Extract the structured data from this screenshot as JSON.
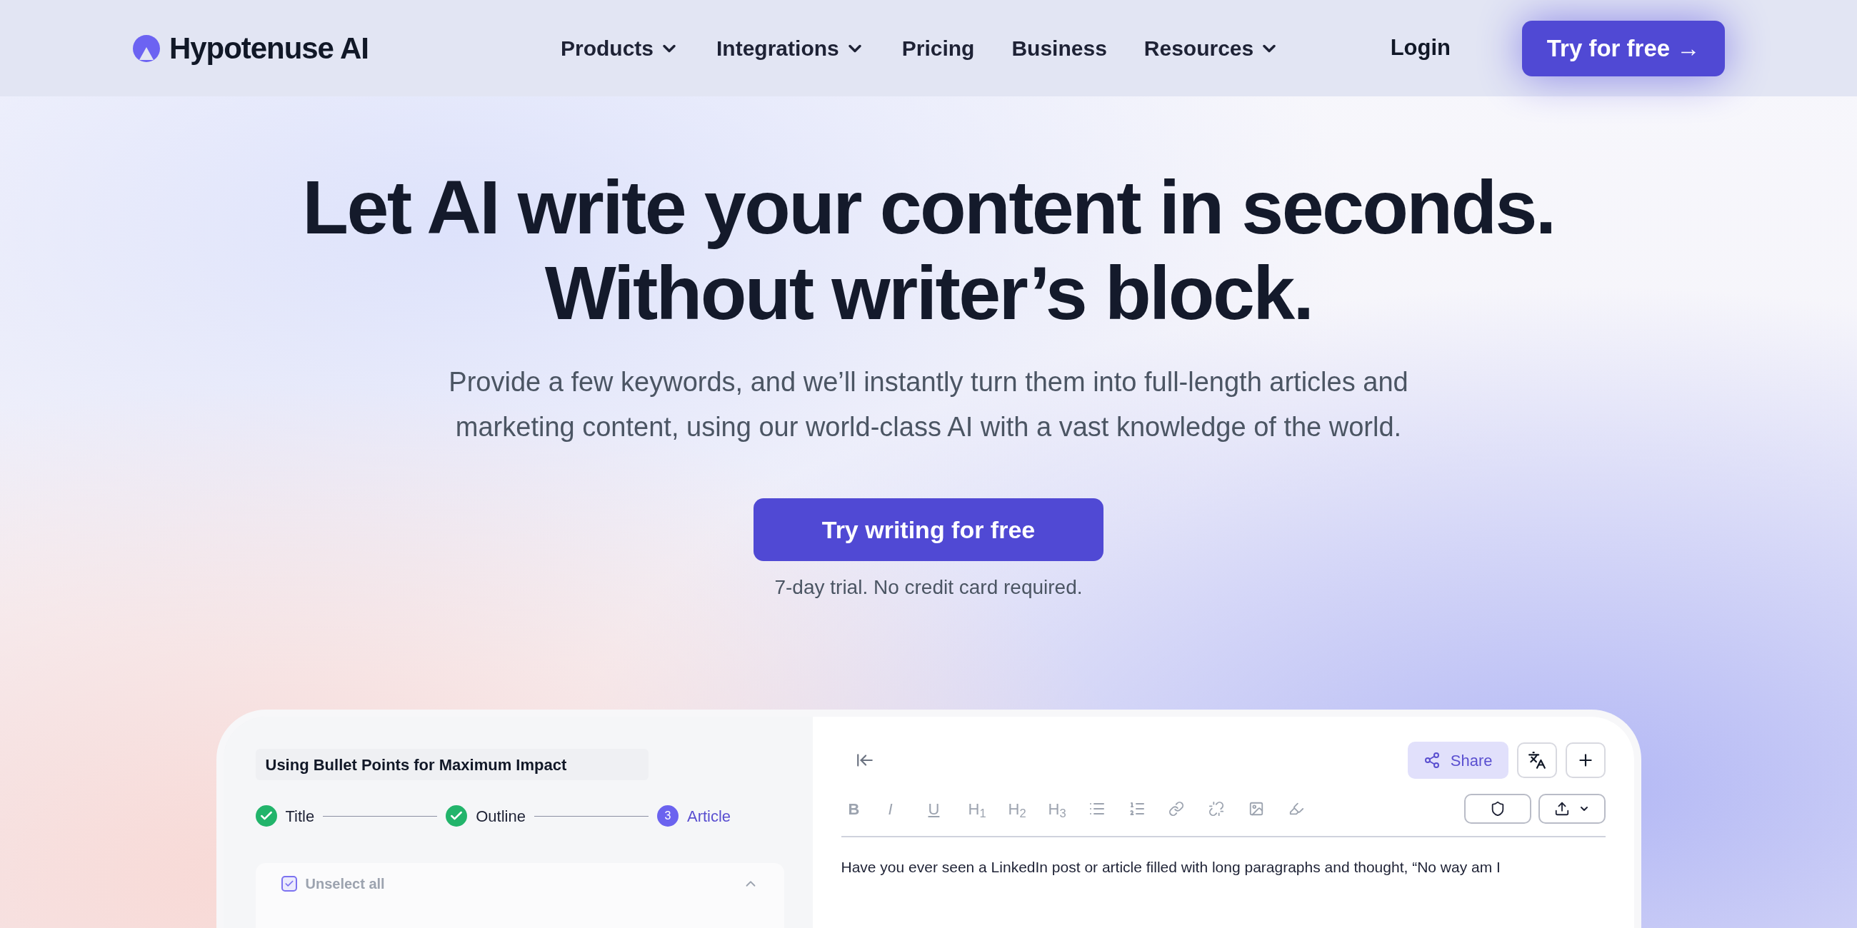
{
  "nav": {
    "logo": "Hypotenuse AI",
    "items": [
      {
        "label": "Products",
        "dropdown": true
      },
      {
        "label": "Integrations",
        "dropdown": true
      },
      {
        "label": "Pricing",
        "dropdown": false
      },
      {
        "label": "Business",
        "dropdown": false
      },
      {
        "label": "Resources",
        "dropdown": true
      }
    ],
    "login": "Login",
    "cta": "Try for free →"
  },
  "hero": {
    "headline": [
      "Let AI write your content in seconds.",
      "Without writer’s block."
    ],
    "subtitle": [
      "Provide a few keywords, and we’ll instantly turn them into full-length articles and",
      "marketing content, using our world-class AI with a vast knowledge of the world."
    ],
    "cta": "Try writing for free",
    "note": "7-day trial. No credit card required."
  },
  "editor": {
    "title": "Using Bullet Points for Maximum Impact",
    "steps": [
      {
        "label": "Title",
        "completed": true,
        "selected": false
      },
      {
        "label": "Outline",
        "completed": true,
        "selected": false
      },
      {
        "label": "Article",
        "completed": false,
        "selected": true,
        "number": "3"
      }
    ],
    "select_all": {
      "label": "Unselect all",
      "checked": true
    },
    "share": "Share",
    "format": [
      "B",
      "I",
      "U",
      "H$_{1}$",
      "H$_{2}$",
      "H$_{3}$"
    ],
    "paragraph": "Have you ever seen a LinkedIn post or article filled with long paragraphs and thought, “No way am I"
  }
}
